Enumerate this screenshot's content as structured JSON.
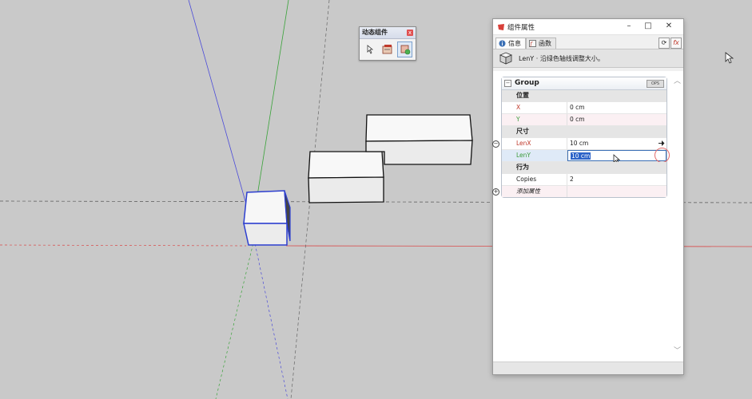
{
  "toolbar": {
    "title": "动态组件",
    "close_label": "x",
    "tools": [
      "interact-tool-icon",
      "component-options-icon",
      "component-attributes-icon"
    ]
  },
  "window": {
    "title": "组件属性",
    "controls": {
      "minimize": "–",
      "maximize": "□",
      "close": "✕"
    },
    "tabs": [
      {
        "label": "信息",
        "icon": "info-icon"
      },
      {
        "label": "函数",
        "icon": "function-icon"
      }
    ],
    "refresh_label": "⟳",
    "formula_label": "fx",
    "description": "LenY · 沿绿色轴线调整大小。"
  },
  "grid": {
    "group_name": "Group",
    "group_badge": "OPS",
    "sections": {
      "position": "位置",
      "size": "尺寸",
      "behavior": "行为"
    },
    "rows": {
      "x": {
        "key": "X",
        "value": "0 cm"
      },
      "y": {
        "key": "Y",
        "value": "0 cm"
      },
      "lenx": {
        "key": "LenX",
        "value": "10 cm"
      },
      "leny": {
        "key": "LenY",
        "value": "10 cm"
      },
      "copies": {
        "key": "Copies",
        "value": "2"
      },
      "add_attr": {
        "key": "添加属性"
      }
    }
  },
  "colors": {
    "x_axis": "#d94a4a",
    "y_axis": "#3aa33a",
    "z_axis": "#4a4ad9",
    "selection": "#2d63c8",
    "background": "#c9c9c9"
  }
}
